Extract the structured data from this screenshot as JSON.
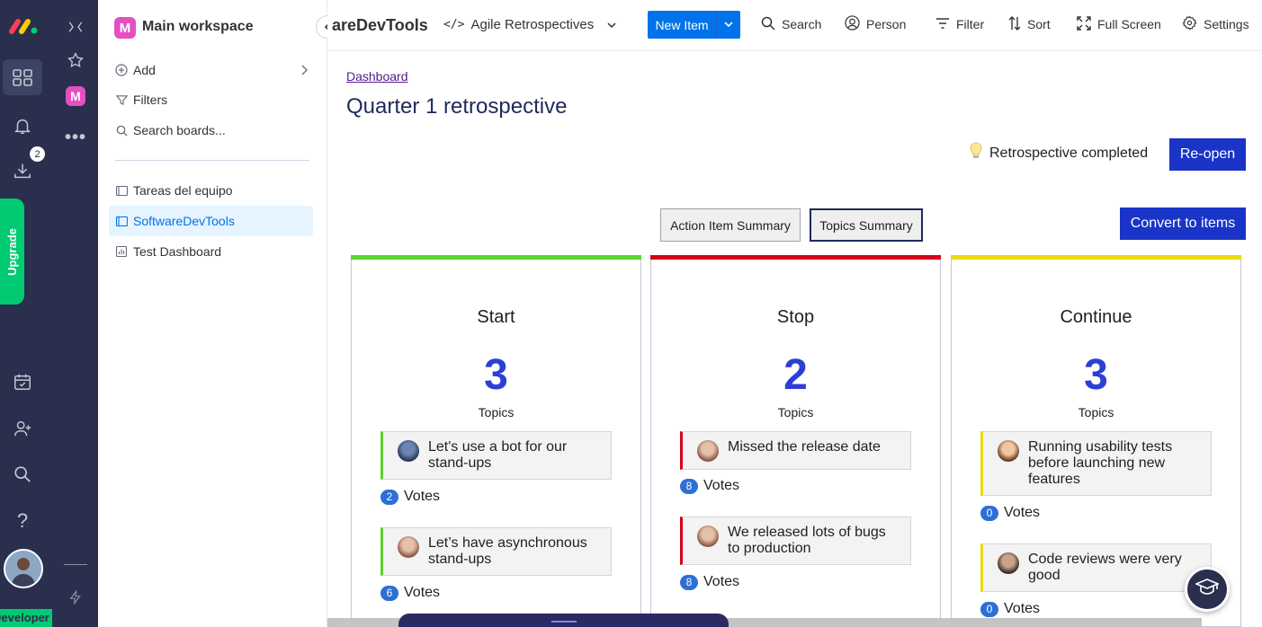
{
  "rail": {
    "download_badge": "2",
    "upgrade_label": "Upgrade",
    "developer_label": "Developer"
  },
  "sidebar": {
    "workspace_initial": "M",
    "workspace_title": "Main workspace",
    "add_label": "Add",
    "filters_label": "Filters",
    "search_label": "Search boards...",
    "boards": [
      {
        "label": "Tareas del equipo"
      },
      {
        "label": "SoftwareDevTools"
      },
      {
        "label": "Test Dashboard"
      }
    ]
  },
  "topbar": {
    "app_title": "areDevTools",
    "board_name": "Agile Retrospectives",
    "new_item": "New Item",
    "search": "Search",
    "person": "Person",
    "filter": "Filter",
    "sort": "Sort",
    "fullscreen": "Full Screen",
    "settings": "Settings"
  },
  "page": {
    "breadcrumb": "Dashboard",
    "title": "Quarter 1 retrospective",
    "status_text": "Retrospective completed",
    "reopen": "Re-open",
    "action_summary": "Action Item Summary",
    "topics_summary": "Topics Summary",
    "convert": "Convert to items",
    "votes_label": "Votes",
    "topics_label": "Topics"
  },
  "columns": [
    {
      "title": "Start",
      "count": "3",
      "color": "#5cd22a",
      "cards": [
        {
          "text": "Let's use a bot for our stand-ups",
          "votes": "2"
        },
        {
          "text": "Let’s have asynchronous stand-ups",
          "votes": "6"
        }
      ]
    },
    {
      "title": "Stop",
      "count": "2",
      "color": "#d8001a",
      "cards": [
        {
          "text": "Missed the release date",
          "votes": "8"
        },
        {
          "text": "We released lots of bugs to production",
          "votes": "8"
        }
      ]
    },
    {
      "title": "Continue",
      "count": "3",
      "color": "#ecd910",
      "cards": [
        {
          "text": "Running usability tests before launching new features",
          "votes": "0"
        },
        {
          "text": "Code reviews were very good",
          "votes": "0"
        }
      ]
    }
  ],
  "colors": {
    "rail": "#292f4c",
    "accent": "#0073ea",
    "primary_button": "#1a34c7"
  }
}
